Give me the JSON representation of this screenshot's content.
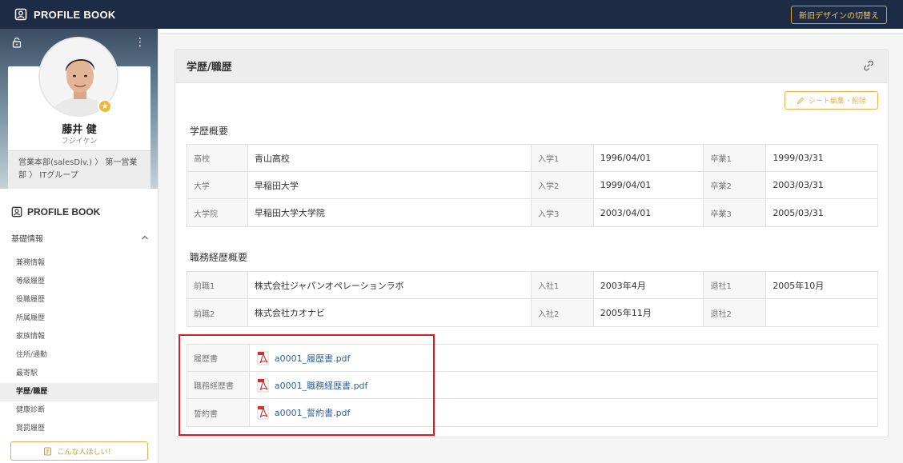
{
  "header": {
    "app_title": "PROFILE BOOK",
    "switch_design_label": "新旧デザインの切替え"
  },
  "sidebar": {
    "profile": {
      "name": "藤井 健",
      "kana": "フジイケン",
      "department": "営業本部(salesDiv.) 〉 第一営業部 〉 ITグループ"
    },
    "brand": "PROFILE BOOK",
    "section_label": "基礎情報",
    "items": [
      {
        "label": "兼務情報",
        "active": false
      },
      {
        "label": "等級履歴",
        "active": false
      },
      {
        "label": "役職履歴",
        "active": false
      },
      {
        "label": "所属履歴",
        "active": false
      },
      {
        "label": "家族情報",
        "active": false
      },
      {
        "label": "住所/通勤",
        "active": false
      },
      {
        "label": "最寄駅",
        "active": false
      },
      {
        "label": "学歴/職歴",
        "active": true
      },
      {
        "label": "健康診断",
        "active": false
      },
      {
        "label": "賞罰履歴",
        "active": false
      }
    ],
    "want_button_label": "こんな人ほしい！"
  },
  "main": {
    "panel_title": "学歴/職歴",
    "edit_button_label": "シート編集・削除",
    "education": {
      "title": "学歴概要",
      "rows": [
        [
          "高校",
          "青山高校",
          "入学1",
          "1996/04/01",
          "卒業1",
          "1999/03/31"
        ],
        [
          "大学",
          "早稲田大学",
          "入学2",
          "1999/04/01",
          "卒業2",
          "2003/03/31"
        ],
        [
          "大学院",
          "早稲田大学大学院",
          "入学3",
          "2003/04/01",
          "卒業3",
          "2005/03/31"
        ]
      ]
    },
    "career": {
      "title": "職務経歴概要",
      "rows": [
        [
          "前職1",
          "株式会社ジャパンオペレーションラボ",
          "入社1",
          "2003年4月",
          "退社1",
          "2005年10月"
        ],
        [
          "前職2",
          "株式会社カオナビ",
          "入社2",
          "2005年11月",
          "退社2",
          ""
        ]
      ]
    },
    "documents": [
      {
        "label": "履歴書",
        "file": "a0001_履歴書.pdf"
      },
      {
        "label": "職務経歴書",
        "file": "a0001_職務経歴書.pdf"
      },
      {
        "label": "誓約書",
        "file": "a0001_誓約書.pdf"
      }
    ]
  },
  "colors": {
    "topbar": "#1e2b45",
    "accent": "#e8b34a",
    "link": "#2f5f9e",
    "highlight": "#d21f2a"
  }
}
